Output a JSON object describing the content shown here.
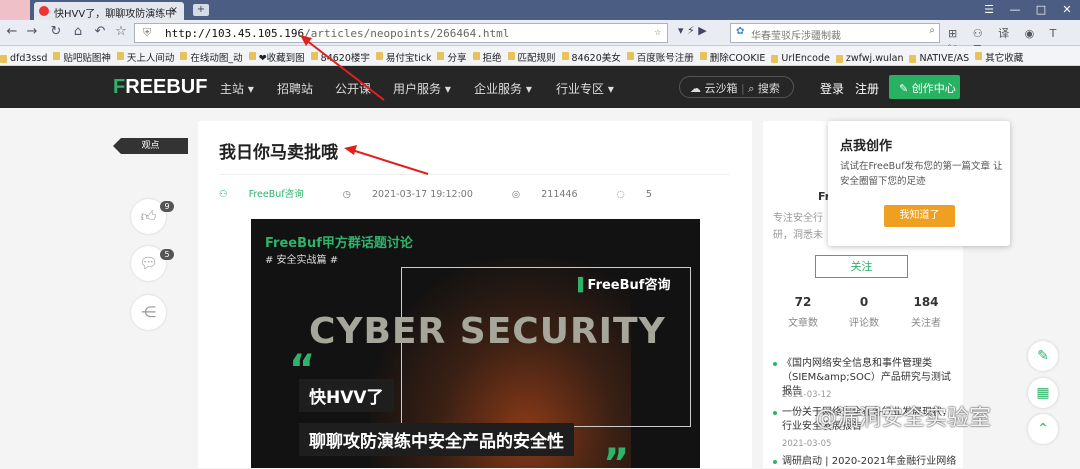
{
  "browser": {
    "tab_title": "快HVV了，聊聊攻防演练中",
    "url_host": "http://103.45.105.196",
    "url_path": "/articles/neopoints/266464.html",
    "search_placeholder": "华春莹驳斥涉疆制裁",
    "bookmarks": [
      "dfd3ssd",
      "贴吧贴图神",
      "天上人间动",
      "在线动图_动",
      "❤收藏到图",
      "84620楼宇",
      "易付宝tick",
      "分享",
      "拒绝",
      "匹配规则",
      "84620美女",
      "百度账号注册",
      "删除COOKIE",
      "UrlEncode",
      "zwfwj.wulan",
      "NATIVE/AS",
      "其它收藏"
    ]
  },
  "site": {
    "logo_prefix": "F",
    "logo_rest": "REEBUF",
    "nav": [
      "主站 ▾",
      "招聘站",
      "公开课",
      "用户服务 ▾",
      "企业服务 ▾",
      "行业专区 ▾"
    ],
    "cloud": "云沙箱",
    "search": "搜索",
    "login": "登录",
    "register": "注册",
    "create": "创作中心"
  },
  "article": {
    "tag": "观点",
    "title": "我日你马卖批哦",
    "source": "FreeBuf咨询",
    "datetime": "2021-03-17 19:12:00",
    "views": "211446",
    "comments": "5",
    "likes_count": "9",
    "comments_count": "5"
  },
  "banner": {
    "topic": "FreeBuf甲方群话题讨论",
    "subtopic": "# 安全实战篇 #",
    "brand": "FreeBuf咨询",
    "big_text": "CYBER SECURITY",
    "line1": "快HVV了",
    "line2": "聊聊攻防演练中安全产品的安全性"
  },
  "popup": {
    "title": "点我创作",
    "desc": "试试在FreeBuf发布您的第一篇文章 让安全圈留下您的足迹",
    "button": "我知道了"
  },
  "author": {
    "name_partial": "Fr",
    "desc_partial": "专注安全行",
    "desc_partial2": "研，洞悉未",
    "follow": "关注",
    "stats": [
      {
        "num": "72",
        "label": "文章数"
      },
      {
        "num": "0",
        "label": "评论数"
      },
      {
        "num": "184",
        "label": "关注者"
      }
    ]
  },
  "news": [
    {
      "title": "《国内网络安全信息和事件管理类（SIEM&amp;SOC）产品研究与测试报告",
      "date": "2021-03-12"
    },
    {
      "title": "一份关于网络安全在各行业发展现状，行业安全发展报告",
      "date": "2021-03-05"
    },
    {
      "title": "调研启动 | 2020-2021年金融行业网络",
      "date": ""
    }
  ],
  "watermark": "@漏洞安全实验室"
}
